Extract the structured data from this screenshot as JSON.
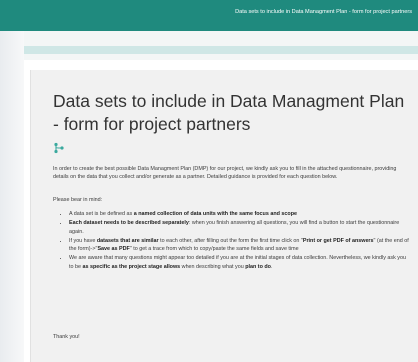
{
  "header": {
    "title": "Data sets to include in Data Managment Plan - form for project partners"
  },
  "form": {
    "title": "Data sets to include in Data Managment Plan - form for project partners",
    "icon": "branch-icon",
    "intro": "In order to create the best possible Data Managment Plan (DMP) for our project, we kindly ask you to fill in the attached questionnaire, providing details on the data that you collect and/or generate as a partner. Detailed guidance is provided for each question below.",
    "bear_in_mind": "Please bear in mind:",
    "bullets": [
      {
        "p1": "A data set is be defined as ",
        "b1": "a named collection of data units with the same focus and scope"
      },
      {
        "b1": "Each dataset needs to be described separately",
        "p1": ": when you finish answering all questions, you will find a button to start the questionnaire again."
      },
      {
        "p1": "If you have ",
        "b1": "datasets that are similar",
        "p2": " to each other, after filling out the form the first time click on \"",
        "b2": "Print or get PDF of answers",
        "p3": "\" (at the end of the form)->\"",
        "b3": "Save as PDF",
        "p4": "\" to get a trace from which to copy/paste the same fields and save time"
      },
      {
        "p1": "We are aware that many questions might appear too detailed if you are at the initial stages of data collection. Nevertheless, we kindly ask you to be ",
        "b1": "as specific as the project stage allows",
        "p2": " when describing what you ",
        "b2": "plan to do",
        "p3": "."
      }
    ],
    "thanks": "Thank you!"
  },
  "colors": {
    "header_bg": "#1f8a7e",
    "accent_strip": "#cfe7e6",
    "card_bg": "#f1f1f1",
    "icon": "#3aa99e"
  }
}
